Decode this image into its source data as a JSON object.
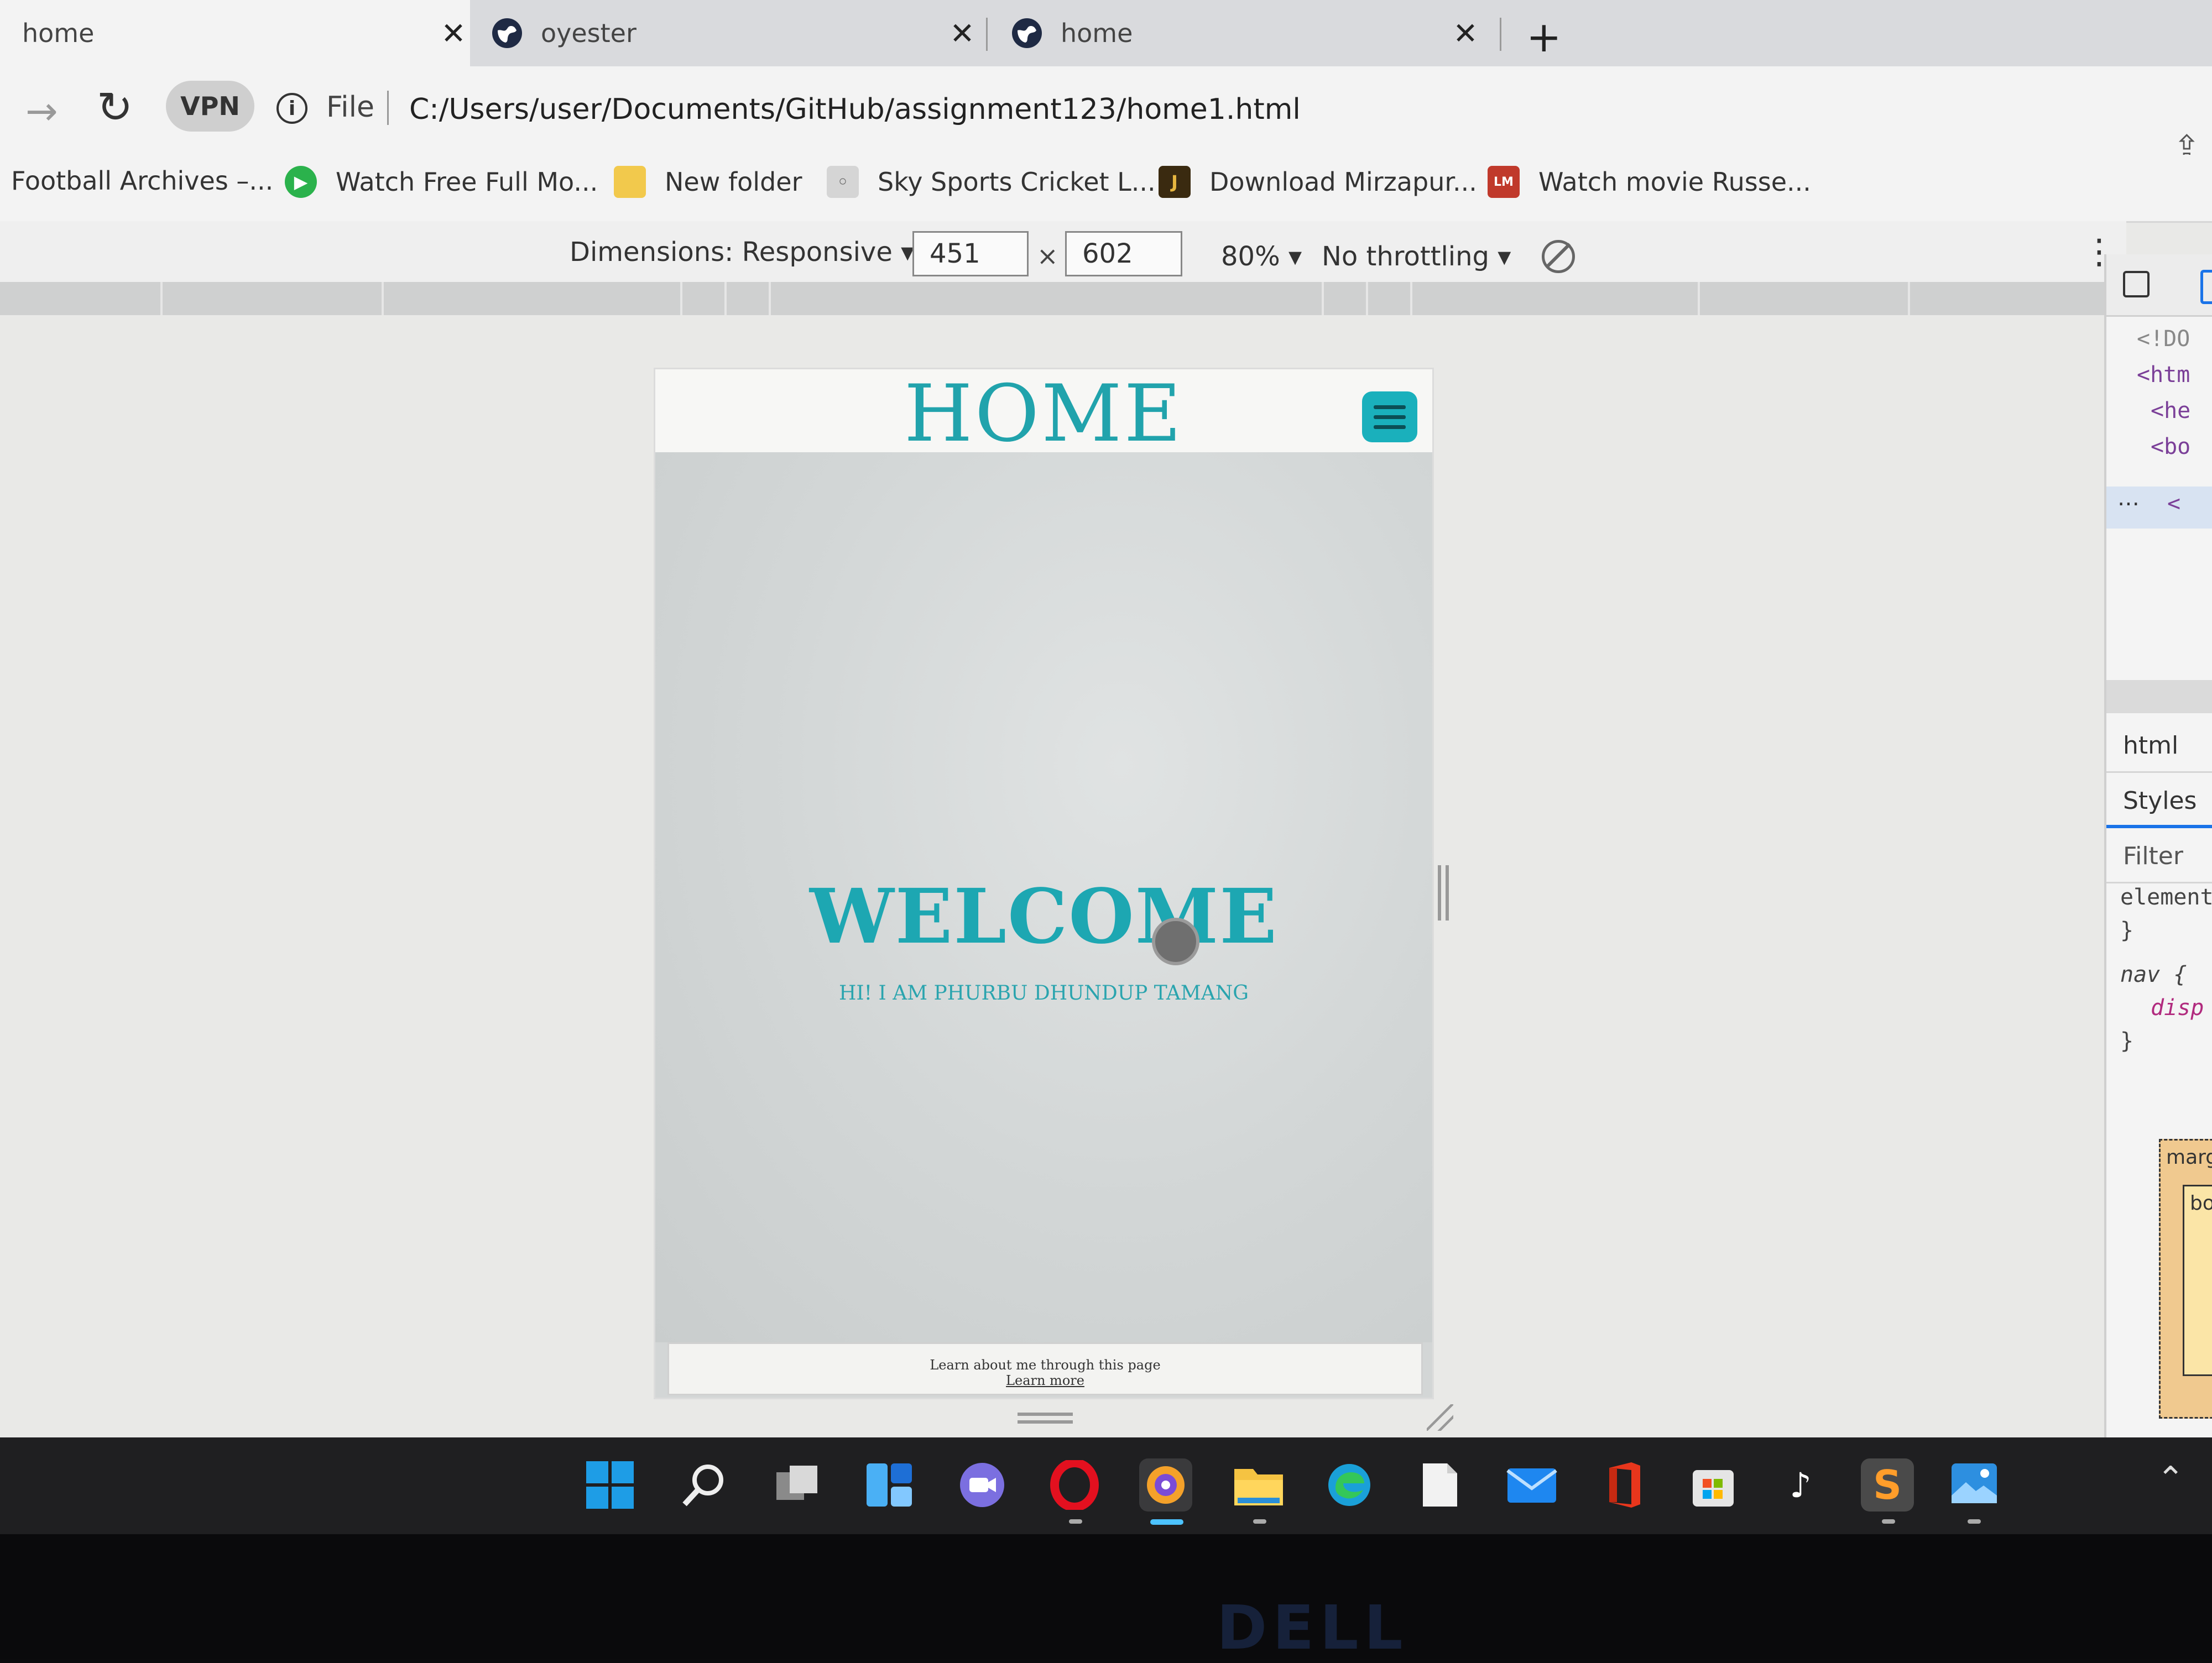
{
  "browser": {
    "tabs": [
      {
        "title": "home",
        "active": true
      },
      {
        "title": "oyester",
        "active": false
      },
      {
        "title": "home",
        "active": false
      }
    ],
    "address": {
      "scheme": "File",
      "url": "C:/Users/user/Documents/GitHub/assignment123/home1.html",
      "vpn_label": "VPN"
    },
    "bookmarks": [
      {
        "label": "Football Archives –..."
      },
      {
        "label": "Watch Free Full Mo..."
      },
      {
        "label": "New folder"
      },
      {
        "label": "Sky Sports Cricket L..."
      },
      {
        "label": "Download Mirzapur..."
      },
      {
        "label": "Watch movie Russe..."
      }
    ]
  },
  "device_toolbar": {
    "dimensions_label": "Dimensions: Responsive",
    "width_value": "451",
    "height_value": "602",
    "times": "×",
    "zoom": "80%",
    "throttling": "No throttling"
  },
  "emulated_page": {
    "header_title": "HOME",
    "welcome": "WELCOME",
    "tagline": "HI! I AM PHURBU DHUNDUP TAMANG",
    "footer_text": "Learn about me through this page",
    "footer_link": "Learn more",
    "accent_color": "#1da7b2"
  },
  "devtools": {
    "dom_lines": [
      "<!DO",
      "<htm",
      "<he",
      "<bo",
      "<"
    ],
    "breadcrumb": "html",
    "styles_tab": "Styles",
    "filter_label": "Filter",
    "rules": [
      "element",
      "}",
      "nav {",
      "disp",
      "}"
    ],
    "boxmodel_margin": "marg",
    "boxmodel_border": "bo"
  },
  "taskbar": {
    "icons": [
      "windows-start-icon",
      "search-icon",
      "task-view-icon",
      "widgets-icon",
      "teams-chat-icon",
      "opera-icon",
      "brave-browser-icon",
      "file-explorer-icon",
      "edge-icon",
      "notepad-icon",
      "mail-icon",
      "office-icon",
      "microsoft-store-icon",
      "tiktok-icon",
      "sublime-text-icon",
      "photos-icon"
    ]
  },
  "hardware": {
    "brand": "DELL"
  }
}
